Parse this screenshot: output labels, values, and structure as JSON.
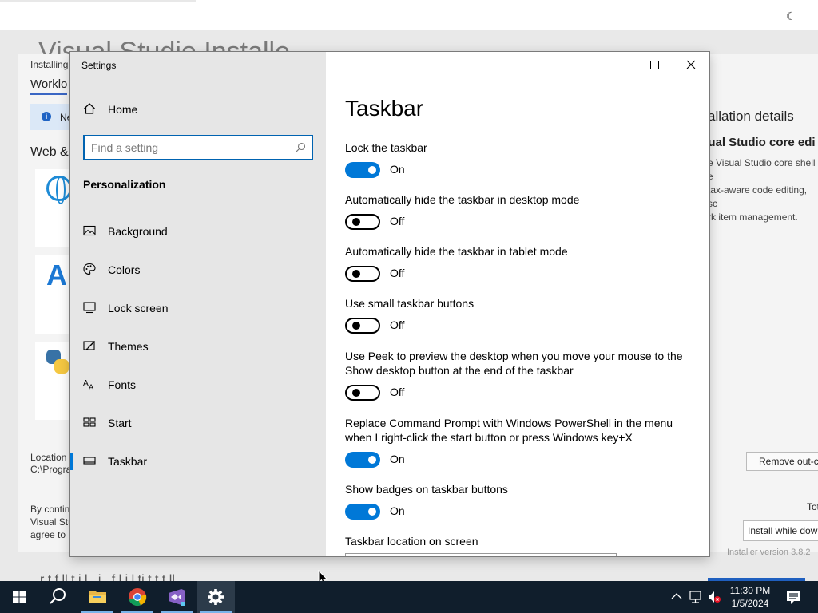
{
  "background_app": {
    "title_partial": "Visual Studio Installe",
    "installing_label": "Installing",
    "workloads_tab": "Worklo",
    "info_text": "Ne",
    "section_web": "Web &",
    "location_label": "Location",
    "location_path": "C:\\Progra",
    "terms_line1": "By contin",
    "terms_line2": "Visual Stu",
    "terms_line3": "agree to",
    "details_heading": "allation details",
    "core_heading": "sual Studio core edi",
    "desc_line1": "e Visual Studio core shell e",
    "desc_line2": "tax-aware code editing, sc",
    "desc_line3": "rk item management.",
    "remove_button": "Remove out-c",
    "total_label": "Tot",
    "install_option": "Install while dow",
    "version_text": "Installer version 3.8.2",
    "status_partial": "r  t        f ll     t    i  l     ,    i          ,       f         l  i  l  ti    t  t  t   ll"
  },
  "settings": {
    "window_title": "Settings",
    "home_label": "Home",
    "search_placeholder": "Find a setting",
    "section_heading": "Personalization",
    "nav_items": [
      {
        "label": "Background",
        "icon": "picture-icon"
      },
      {
        "label": "Colors",
        "icon": "palette-icon"
      },
      {
        "label": "Lock screen",
        "icon": "lock-screen-icon"
      },
      {
        "label": "Themes",
        "icon": "brush-icon"
      },
      {
        "label": "Fonts",
        "icon": "fonts-icon"
      },
      {
        "label": "Start",
        "icon": "start-icon"
      },
      {
        "label": "Taskbar",
        "icon": "taskbar-icon",
        "active": true
      }
    ],
    "page_title": "Taskbar",
    "options": [
      {
        "label": "Lock the taskbar",
        "state": "On"
      },
      {
        "label": "Automatically hide the taskbar in desktop mode",
        "state": "Off"
      },
      {
        "label": "Automatically hide the taskbar in tablet mode",
        "state": "Off"
      },
      {
        "label": "Use small taskbar buttons",
        "state": "Off"
      },
      {
        "label_line1": "Use Peek to preview the desktop when you move your mouse to the",
        "label_line2": "Show desktop button at the end of the taskbar",
        "state": "Off"
      },
      {
        "label_line1": "Replace Command Prompt with Windows PowerShell in the menu",
        "label_line2": "when I right-click the start button or press Windows key+X",
        "state": "On"
      },
      {
        "label": "Show badges on taskbar buttons",
        "state": "On"
      }
    ],
    "location_label": "Taskbar location on screen"
  },
  "taskbar": {
    "apps": [
      "start-icon",
      "search-icon",
      "file-explorer-icon",
      "chrome-icon",
      "visual-studio-installer-icon",
      "settings-icon"
    ],
    "clock_time": "11:30 PM",
    "clock_date": "1/5/2024"
  },
  "colors": {
    "accent": "#0078d7",
    "taskbar_bg": "#101e2c",
    "left_pane_bg": "#e6e6e6"
  }
}
